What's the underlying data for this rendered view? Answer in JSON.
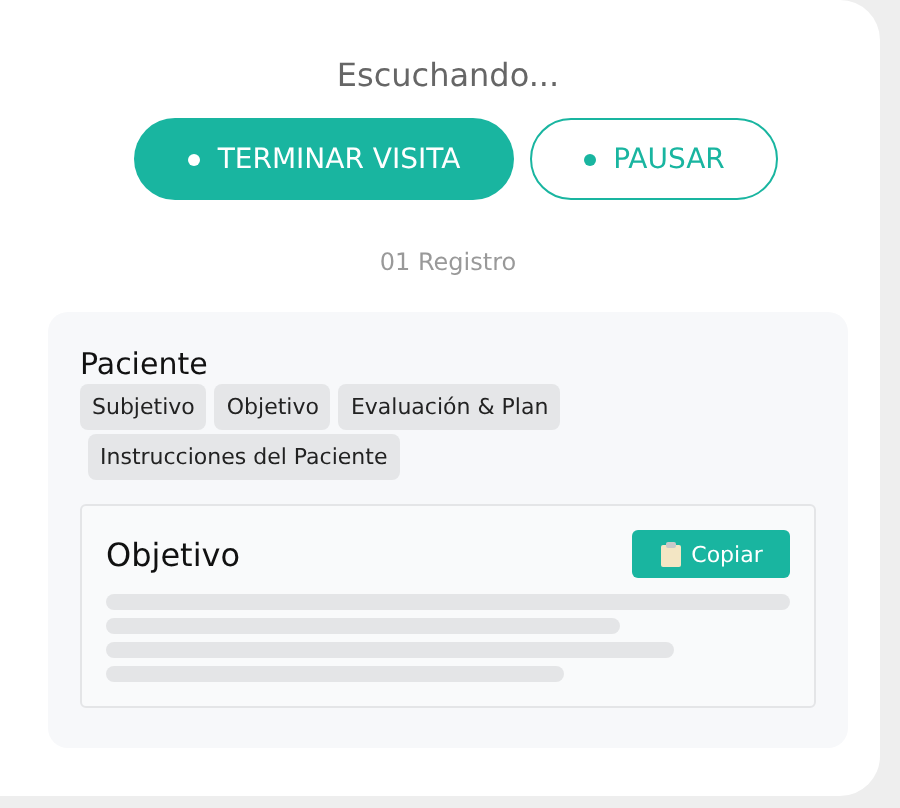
{
  "status": "Escuchando...",
  "buttons": [
    {
      "label": "TERMINAR VISITA",
      "kind": "primary"
    },
    {
      "label": "PAUSAR",
      "kind": "outline"
    }
  ],
  "record_count": "01 Registro",
  "panel": {
    "title": "Paciente",
    "tabs": [
      "Subjetivo",
      "Objetivo",
      "Evaluación & Plan",
      "Instrucciones del Paciente"
    ],
    "section": {
      "title": "Objetivo",
      "copy_button": "Copiar"
    }
  }
}
